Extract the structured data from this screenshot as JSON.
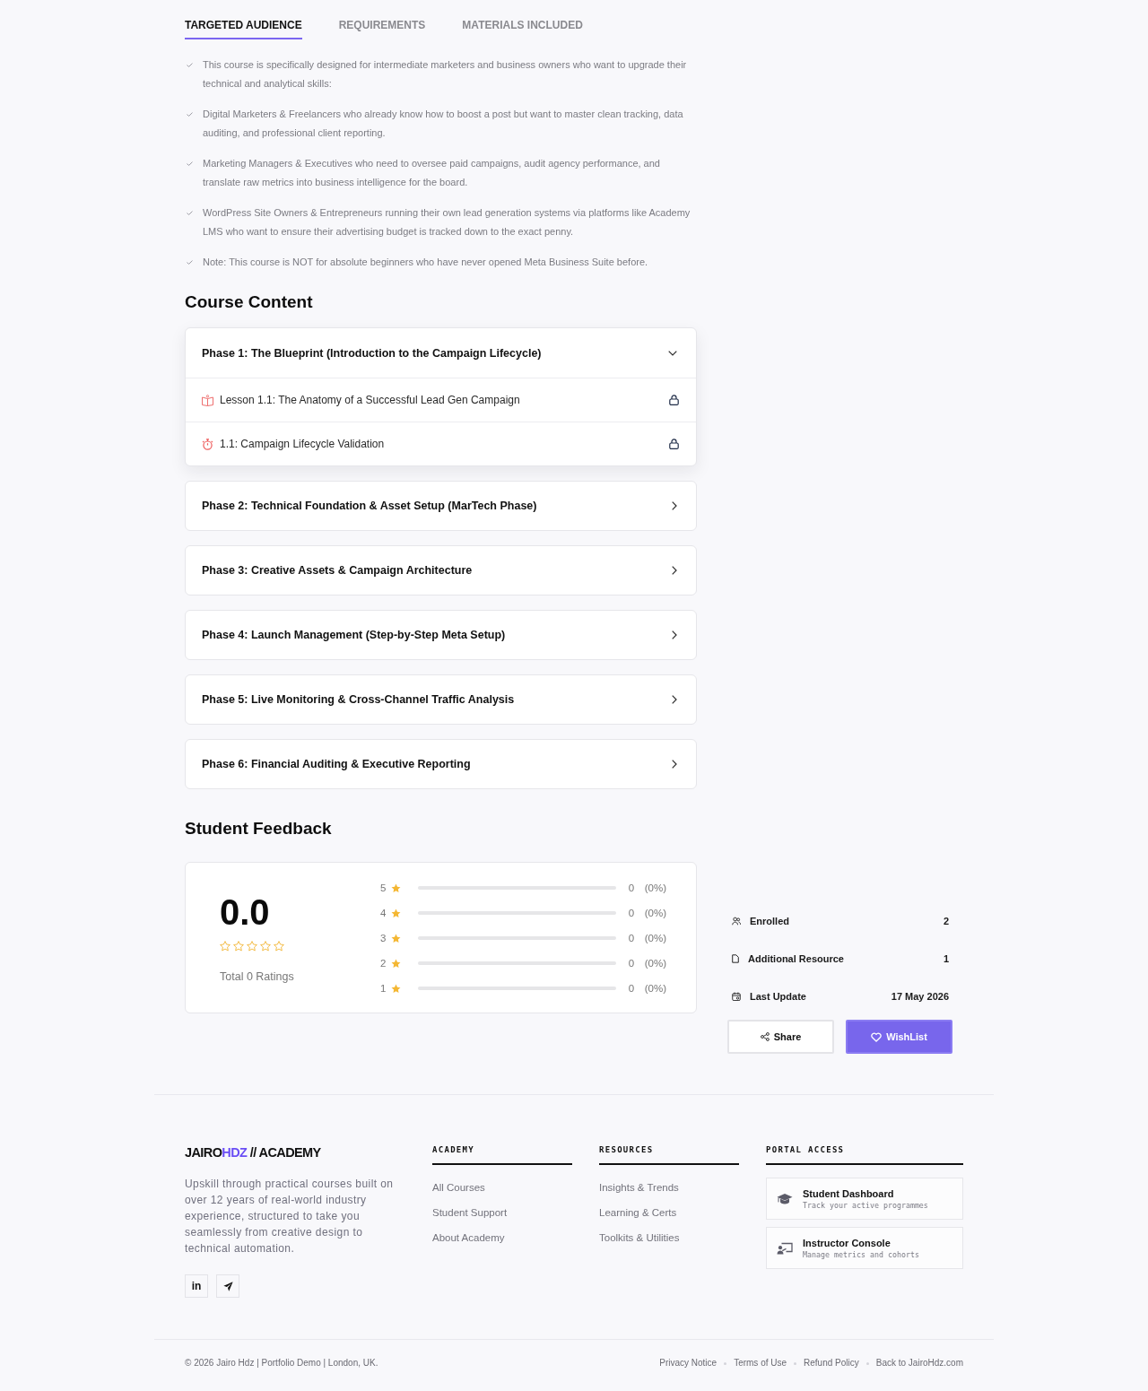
{
  "tabs": [
    {
      "label": "TARGETED AUDIENCE",
      "selected": true
    },
    {
      "label": "REQUIREMENTS",
      "selected": false
    },
    {
      "label": "MATERIALS INCLUDED",
      "selected": false
    }
  ],
  "audience_list": [
    "This course is specifically designed for intermediate marketers and business owners who want to upgrade their technical and analytical skills:",
    "Digital Marketers & Freelancers who already know how to boost a post but want to master clean tracking, data auditing, and professional client reporting.",
    "Marketing Managers & Executives who need to oversee paid campaigns, audit agency performance, and translate raw metrics into business intelligence for the board.",
    "WordPress Site Owners & Entrepreneurs running their own lead generation systems via platforms like Academy LMS who want to ensure their advertising budget is tracked down to the exact penny.",
    "Note: This course is NOT for absolute beginners who have never opened Meta Business Suite before."
  ],
  "course_content": {
    "heading": "Course Content",
    "phases": [
      {
        "title": "Phase 1: The Blueprint (Introduction to the Campaign Lifecycle)",
        "expanded": true,
        "lessons": [
          {
            "kind": "lesson",
            "title": "Lesson 1.1: The Anatomy of a Successful Lead Gen Campaign",
            "locked": true
          },
          {
            "kind": "quiz",
            "title": "1.1: Campaign Lifecycle Validation",
            "locked": true
          }
        ]
      },
      {
        "title": "Phase 2: Technical Foundation & Asset Setup (MarTech Phase)",
        "expanded": false
      },
      {
        "title": "Phase 3: Creative Assets & Campaign Architecture",
        "expanded": false
      },
      {
        "title": "Phase 4: Launch Management (Step-by-Step Meta Setup)",
        "expanded": false
      },
      {
        "title": "Phase 5: Live Monitoring & Cross-Channel Traffic Analysis",
        "expanded": false
      },
      {
        "title": "Phase 6: Financial Auditing & Executive Reporting",
        "expanded": false
      }
    ]
  },
  "student_feedback": {
    "heading": "Student Feedback",
    "average": "0.0",
    "stars": 0,
    "total": "Total 0 Ratings",
    "breakdown": [
      {
        "label": "5",
        "count": "0",
        "percent": "(0%)"
      },
      {
        "label": "4",
        "count": "0",
        "percent": "(0%)"
      },
      {
        "label": "3",
        "count": "0",
        "percent": "(0%)"
      },
      {
        "label": "2",
        "count": "0",
        "percent": "(0%)"
      },
      {
        "label": "1",
        "count": "0",
        "percent": "(0%)"
      }
    ]
  },
  "course_info": {
    "items": [
      {
        "kind": "enrolled",
        "label": "Enrolled",
        "value": "2"
      },
      {
        "kind": "resource",
        "label": "Additional Resource",
        "value": "1"
      },
      {
        "kind": "update",
        "label": "Last Update",
        "value": "17 May 2026"
      }
    ],
    "buttons": [
      {
        "kind": "share",
        "label": "Share"
      },
      {
        "kind": "wishlist",
        "label": "WishList"
      }
    ]
  },
  "footer": {
    "brand": [
      {
        "text": "JAIRO",
        "highlighted": false
      },
      {
        "text": "HDZ",
        "highlighted": true
      },
      {
        "text": " // ACADEMY",
        "highlighted": false
      }
    ],
    "description": "Upskill through practical courses built on over 12 years of real-world industry experience, structured to take you seamlessly from creative design to technical automation.",
    "socials": [
      {
        "kind": "linkedin",
        "label": "in"
      },
      {
        "kind": "telegram"
      }
    ],
    "columns": [
      {
        "heading": "ACADEMY",
        "links": [
          "All Courses",
          "Student Support",
          "About Academy"
        ]
      },
      {
        "heading": "RESOURCES",
        "links": [
          "Insights & Trends",
          "Learning & Certs",
          "Toolkits & Utilities"
        ]
      }
    ],
    "portal": {
      "heading": "PORTAL ACCESS",
      "cards": [
        {
          "kind": "student",
          "title": "Student Dashboard",
          "subtitle": "Track your active programmes"
        },
        {
          "kind": "instructor",
          "title": "Instructor Console",
          "subtitle": "Manage metrics and cohorts"
        }
      ]
    },
    "copyright": "© 2026 Jairo Hdz | Portfolio Demo | London, UK.",
    "legal_links": [
      "Privacy Notice",
      "Terms of Use",
      "Refund Policy",
      "Back to JairoHdz.com"
    ]
  }
}
